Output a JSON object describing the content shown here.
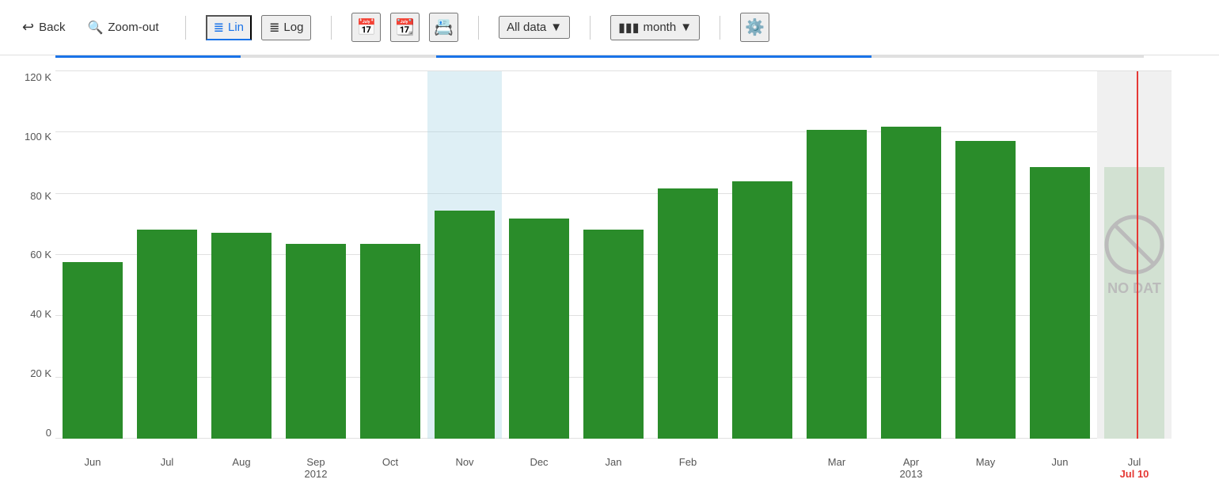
{
  "toolbar": {
    "back_label": "Back",
    "zoom_out_label": "Zoom-out",
    "lin_label": "Lin",
    "log_label": "Log",
    "all_data_label": "All data",
    "month_label": "month",
    "settings_label": "⚙"
  },
  "chart": {
    "y_labels": [
      "0",
      "20 K",
      "40 K",
      "60 K",
      "80 K",
      "100 K",
      "120 K"
    ],
    "x_labels": [
      {
        "month": "Jun",
        "year": ""
      },
      {
        "month": "Jul",
        "year": ""
      },
      {
        "month": "Aug",
        "year": ""
      },
      {
        "month": "Sep",
        "year": "2012"
      },
      {
        "month": "Oct",
        "year": ""
      },
      {
        "month": "Nov",
        "year": ""
      },
      {
        "month": "Dec",
        "year": ""
      },
      {
        "month": "Jan",
        "year": ""
      },
      {
        "month": "Feb",
        "year": ""
      },
      {
        "month": "Mar",
        "year": ""
      },
      {
        "month": "Apr",
        "year": "2013"
      },
      {
        "month": "May",
        "year": ""
      },
      {
        "month": "Jun",
        "year": ""
      },
      {
        "month": "Jul",
        "year": ""
      }
    ],
    "bars": [
      {
        "month": "Jun",
        "value": 60000,
        "height_pct": 48,
        "highlighted": false,
        "no_data": false
      },
      {
        "month": "Jul",
        "value": 71000,
        "height_pct": 57,
        "highlighted": false,
        "no_data": false
      },
      {
        "month": "Aug",
        "value": 70000,
        "height_pct": 56,
        "highlighted": false,
        "no_data": false
      },
      {
        "month": "Sep",
        "value": 67000,
        "height_pct": 53,
        "highlighted": false,
        "no_data": false
      },
      {
        "month": "Oct",
        "value": 67000,
        "height_pct": 53,
        "highlighted": false,
        "no_data": false
      },
      {
        "month": "Nov",
        "value": 77000,
        "height_pct": 62,
        "highlighted": true,
        "no_data": false
      },
      {
        "month": "Dec",
        "value": 75000,
        "height_pct": 60,
        "highlighted": false,
        "no_data": false
      },
      {
        "month": "Jan",
        "value": 71000,
        "height_pct": 57,
        "highlighted": false,
        "no_data": false
      },
      {
        "month": "Feb",
        "value": 85000,
        "height_pct": 68,
        "highlighted": false,
        "no_data": false
      },
      {
        "month": "Mar2",
        "value": 87000,
        "height_pct": 70,
        "highlighted": false,
        "no_data": false
      },
      {
        "month": "Mar",
        "value": 105000,
        "height_pct": 84,
        "highlighted": false,
        "no_data": false
      },
      {
        "month": "Apr",
        "value": 106000,
        "height_pct": 85,
        "highlighted": false,
        "no_data": false
      },
      {
        "month": "May",
        "value": 101000,
        "height_pct": 81,
        "highlighted": false,
        "no_data": false
      },
      {
        "month": "Jun2",
        "value": 93000,
        "height_pct": 74,
        "highlighted": false,
        "no_data": false
      },
      {
        "month": "Jul",
        "value": 93000,
        "height_pct": 74,
        "highlighted": false,
        "no_data": true
      }
    ],
    "no_data_label": "NO DAT",
    "red_line_label": "Jul 10",
    "max_value": 125000
  }
}
